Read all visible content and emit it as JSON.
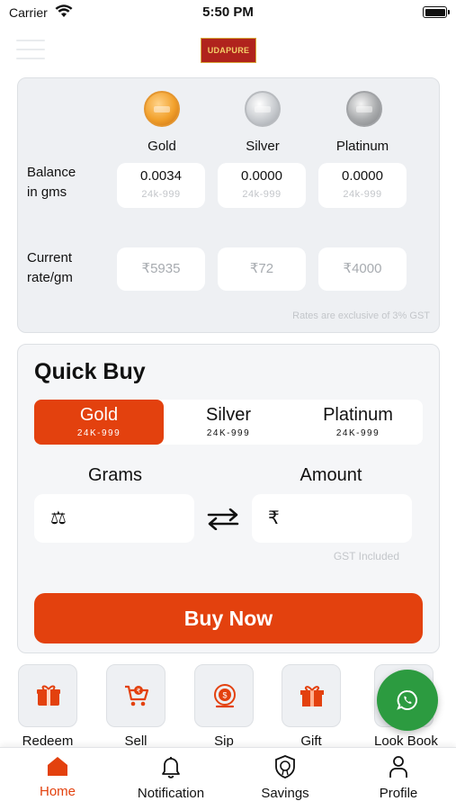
{
  "status_bar": {
    "carrier": "Carrier",
    "time": "5:50 PM"
  },
  "header": {
    "logo_text": "UDAPURE"
  },
  "balance_card": {
    "metals": [
      {
        "name": "Gold",
        "balance": "0.0034",
        "purity": "24k-999",
        "rate": "₹5935",
        "coin_color": "#f2a12c"
      },
      {
        "name": "Silver",
        "balance": "0.0000",
        "purity": "24k-999",
        "rate": "₹72",
        "coin_color": "#c9ccd0"
      },
      {
        "name": "Platinum",
        "balance": "0.0000",
        "purity": "24k-999",
        "rate": "₹4000",
        "coin_color": "#a9abad"
      }
    ],
    "balance_label_line1": "Balance",
    "balance_label_line2": "in gms",
    "rate_label_line1": "Current",
    "rate_label_line2": "rate/gm",
    "note": "Rates are exclusive of 3% GST"
  },
  "quick_buy": {
    "title": "Quick Buy",
    "tabs": [
      {
        "name": "Gold",
        "purity": "24K-999",
        "active": true
      },
      {
        "name": "Silver",
        "purity": "24K-999",
        "active": false
      },
      {
        "name": "Platinum",
        "purity": "24K-999",
        "active": false
      }
    ],
    "grams_label": "Grams",
    "amount_label": "Amount",
    "grams_icon": "⚖",
    "amount_icon": "₹",
    "gst_note": "GST Included",
    "buy_button": "Buy Now"
  },
  "actions": [
    {
      "label": "Redeem",
      "icon": "redeem-icon"
    },
    {
      "label": "Sell",
      "icon": "cart-icon"
    },
    {
      "label": "Sip",
      "icon": "sip-icon"
    },
    {
      "label": "Gift",
      "icon": "gift-icon"
    },
    {
      "label": "Look Book",
      "icon": "lookbook-icon"
    }
  ],
  "tabs": [
    {
      "label": "Home",
      "icon": "home-icon",
      "active": true
    },
    {
      "label": "Notification",
      "icon": "bell-icon",
      "active": false
    },
    {
      "label": "Savings",
      "icon": "savings-icon",
      "active": false
    },
    {
      "label": "Profile",
      "icon": "person-icon",
      "active": false
    }
  ],
  "colors": {
    "accent": "#e3410e",
    "whatsapp": "#2c9b40",
    "card_bg": "#eef0f3"
  }
}
